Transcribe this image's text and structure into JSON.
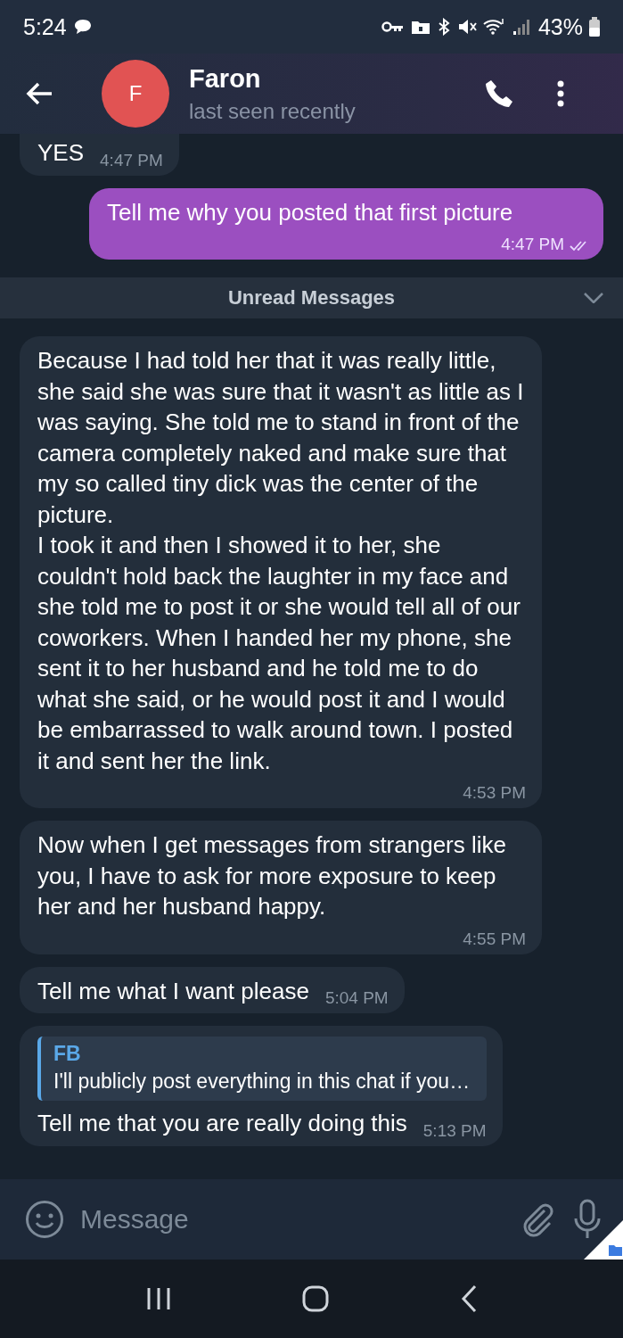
{
  "status_bar": {
    "time": "5:24",
    "battery": "43%"
  },
  "header": {
    "avatar_letter": "F",
    "name": "Faron",
    "status": "last seen recently"
  },
  "messages": [
    {
      "kind": "incoming",
      "text": "YES",
      "time": "4:47 PM"
    },
    {
      "kind": "outgoing",
      "text": "Tell me why you posted that first picture",
      "time": "4:47 PM",
      "read": true
    },
    {
      "kind": "divider",
      "text": "Unread Messages"
    },
    {
      "kind": "incoming",
      "text": "Because I had told her that it was really little, she said she was sure that it wasn't as little as I was saying. She told me to stand in front of the camera completely naked and make sure that my so called tiny dick was the center of the picture.\nI took it and then I showed it to her, she couldn't hold back the laughter in my face and she told me to post it or she would tell all of our coworkers. When I handed her my phone, she sent it to her husband and he told me to do what she said, or he would post it and I would be embarrassed to walk around town. I posted it and sent her the link.",
      "time": "4:53 PM"
    },
    {
      "kind": "incoming",
      "text": "Now when I get messages from strangers like you, I have to ask for more exposure to keep her and her husband happy.",
      "time": "4:55 PM"
    },
    {
      "kind": "incoming",
      "text": "Tell me what I want please",
      "time": "5:04 PM"
    },
    {
      "kind": "incoming",
      "text": "Tell me that you are really doing this",
      "time": "5:13 PM",
      "reply": {
        "author": "FB",
        "text": "I'll publicly post everything in this chat if you…"
      }
    }
  ],
  "composer": {
    "placeholder": "Message"
  }
}
